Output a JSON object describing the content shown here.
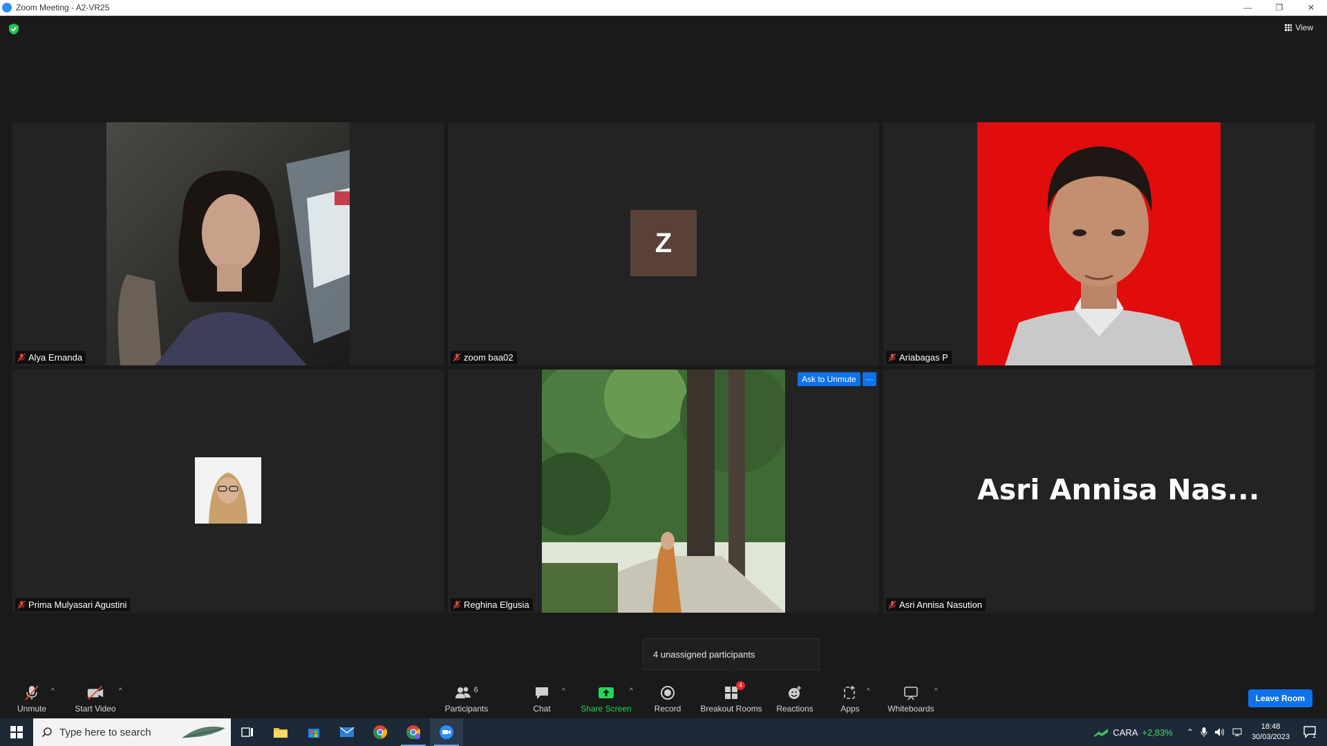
{
  "window": {
    "title": "Zoom Meeting - A2-VR25"
  },
  "header": {
    "view_label": "View"
  },
  "tiles": [
    {
      "name": "Alya Ernanda"
    },
    {
      "name": "zoom baa02",
      "avatar_letter": "Z"
    },
    {
      "name": "Ariabagas P"
    },
    {
      "name": "Prima Mulyasari Agustini"
    },
    {
      "name": "Reghina Elgusia",
      "ask_label": "Ask to Unmute",
      "more_label": "···"
    },
    {
      "name": "Asri Annisa Nasution",
      "big_name": "Asri Annisa Nas..."
    }
  ],
  "tooltip": {
    "text": "4 unassigned participants"
  },
  "toolbar": {
    "unmute": "Unmute",
    "start_video": "Start Video",
    "participants": "Participants",
    "participants_count": "6",
    "chat": "Chat",
    "share_screen": "Share Screen",
    "record": "Record",
    "breakout_rooms": "Breakout Rooms",
    "breakout_badge": "4",
    "reactions": "Reactions",
    "apps": "Apps",
    "whiteboards": "Whiteboards",
    "leave": "Leave Room"
  },
  "taskbar": {
    "search_placeholder": "Type here to search",
    "stock_name": "CARA",
    "stock_change": "+2,83%",
    "time": "18:48",
    "date": "30/03/2023",
    "notification_count": "1"
  },
  "colors": {
    "accent": "#0e72ed",
    "share_green": "#23d959",
    "badge_red": "#e02828"
  }
}
